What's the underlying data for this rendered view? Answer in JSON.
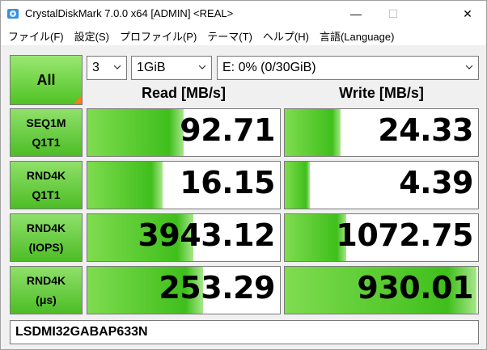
{
  "window": {
    "title": "CrystalDiskMark 7.0.0 x64 [ADMIN] <REAL>",
    "controls": {
      "minimize": "—",
      "maximize": "☐",
      "close": "✕"
    }
  },
  "menu": {
    "items": [
      {
        "label": "ファイル(F)"
      },
      {
        "label": "設定(S)"
      },
      {
        "label": "プロファイル(P)"
      },
      {
        "label": "テーマ(T)"
      },
      {
        "label": "ヘルプ(H)"
      },
      {
        "label": "言語(Language)"
      }
    ]
  },
  "toolbar": {
    "all_label": "All",
    "count": "3",
    "size": "1GiB",
    "drive": "E: 0% (0/30GiB)"
  },
  "columns": {
    "read": "Read [MB/s]",
    "write": "Write [MB/s]"
  },
  "rows": [
    {
      "line1": "SEQ1M",
      "line2": "Q1T1",
      "read": "92.71",
      "write": "24.33",
      "read_fill": 0.5,
      "write_fill": 0.29
    },
    {
      "line1": "RND4K",
      "line2": "Q1T1",
      "read": "16.15",
      "write": "4.39",
      "read_fill": 0.39,
      "write_fill": 0.13
    },
    {
      "line1": "RND4K",
      "line2": "(IOPS)",
      "read": "3943.12",
      "write": "1072.75",
      "read_fill": 0.55,
      "write_fill": 0.32
    },
    {
      "line1": "RND4K",
      "line2": "(μs)",
      "read": "253.29",
      "write": "930.01",
      "read_fill": 0.6,
      "write_fill": 0.99
    }
  ],
  "comment": "LSDMI32GABAP633N",
  "colors": {
    "accent_green": "#4fc324",
    "bar_green": "#3fbf1c",
    "corner_orange": "#ff7a1a"
  }
}
